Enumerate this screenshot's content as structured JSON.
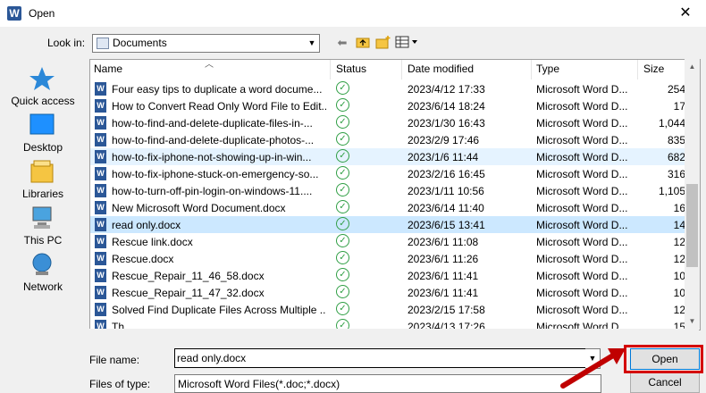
{
  "window": {
    "title": "Open",
    "app_icon": "W"
  },
  "lookin": {
    "label": "Look in:",
    "value": "Documents"
  },
  "places": [
    {
      "label": "Quick access",
      "icon": "star-icon"
    },
    {
      "label": "Desktop",
      "icon": "desktop-icon"
    },
    {
      "label": "Libraries",
      "icon": "libraries-icon"
    },
    {
      "label": "This PC",
      "icon": "computer-icon"
    },
    {
      "label": "Network",
      "icon": "network-icon"
    }
  ],
  "columns": {
    "name": "Name",
    "status": "Status",
    "date": "Date modified",
    "type": "Type",
    "size": "Size"
  },
  "files": [
    {
      "name": "Four easy  tips to duplicate a word docume...",
      "date": "2023/4/12 17:33",
      "type": "Microsoft Word D...",
      "size": "254"
    },
    {
      "name": "How to Convert Read Only Word File to Edit...",
      "date": "2023/6/14 18:24",
      "type": "Microsoft Word D...",
      "size": "17"
    },
    {
      "name": "how-to-find-and-delete-duplicate-files-in-...",
      "date": "2023/1/30 16:43",
      "type": "Microsoft Word D...",
      "size": "1,044"
    },
    {
      "name": "how-to-find-and-delete-duplicate-photos-...",
      "date": "2023/2/9 17:46",
      "type": "Microsoft Word D...",
      "size": "835"
    },
    {
      "name": "how-to-fix-iphone-not-showing-up-in-win...",
      "date": "2023/1/6 11:44",
      "type": "Microsoft Word D...",
      "size": "682"
    },
    {
      "name": "how-to-fix-iphone-stuck-on-emergency-so...",
      "date": "2023/2/16 16:45",
      "type": "Microsoft Word D...",
      "size": "316"
    },
    {
      "name": "how-to-turn-off-pin-login-on-windows-11....",
      "date": "2023/1/11 10:56",
      "type": "Microsoft Word D...",
      "size": "1,105"
    },
    {
      "name": "New Microsoft Word Document.docx",
      "date": "2023/6/14 11:40",
      "type": "Microsoft Word D...",
      "size": "16"
    },
    {
      "name": "read only.docx",
      "date": "2023/6/15 13:41",
      "type": "Microsoft Word D...",
      "size": "14"
    },
    {
      "name": "Rescue link.docx",
      "date": "2023/6/1 11:08",
      "type": "Microsoft Word D...",
      "size": "12"
    },
    {
      "name": "Rescue.docx",
      "date": "2023/6/1 11:26",
      "type": "Microsoft Word D...",
      "size": "12"
    },
    {
      "name": "Rescue_Repair_11_46_58.docx",
      "date": "2023/6/1 11:41",
      "type": "Microsoft Word D...",
      "size": "10"
    },
    {
      "name": "Rescue_Repair_11_47_32.docx",
      "date": "2023/6/1 11:41",
      "type": "Microsoft Word D...",
      "size": "10"
    },
    {
      "name": "Solved Find Duplicate Files Across Multiple ...",
      "date": "2023/2/15 17:58",
      "type": "Microsoft Word D...",
      "size": "12"
    },
    {
      "name": "Th...",
      "date": "2023/4/13 17:26",
      "type": "Microsoft Word D...",
      "size": "15"
    }
  ],
  "filename": {
    "label": "File name:",
    "value": "read only.docx"
  },
  "filetype": {
    "label": "Files of type:",
    "value": "Microsoft Word Files(*.doc;*.docx)"
  },
  "buttons": {
    "open": "Open",
    "cancel": "Cancel"
  },
  "colors": {
    "highlight": "#d40000",
    "selection": "#cce8ff",
    "hover": "#e5f3ff",
    "word_blue": "#2b5797",
    "status_green": "#2f9e44"
  }
}
